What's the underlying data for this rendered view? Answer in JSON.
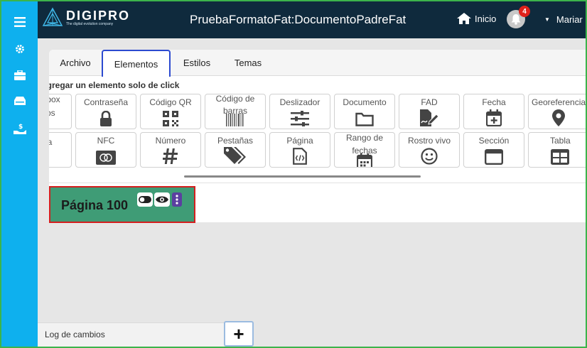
{
  "brand": {
    "name": "DIGIPRO",
    "tagline": "The digital evolution company",
    "accent": "#0eb0ee"
  },
  "header": {
    "title": "PruebaFormatoFat:DocumentoPadreFat",
    "home_label": "Inicio",
    "notifications_count": "4",
    "user_name": "Mariar",
    "user_paren": "("
  },
  "sidebar": {
    "items": [
      "menu-icon",
      "gear-icon",
      "toolbox-icon",
      "drive-icon",
      "money-hand-icon"
    ]
  },
  "tabs": [
    {
      "label": "Archivo"
    },
    {
      "label": "Elementos",
      "active": true
    },
    {
      "label": "Estilos"
    },
    {
      "label": "Temas"
    }
  ],
  "elements": {
    "hint": "Agregar un elemento solo de click",
    "row1": [
      {
        "label": "Checkbox\nGrupos"
      },
      {
        "label": "Contraseña",
        "icon": "lock-icon"
      },
      {
        "label": "Código QR",
        "icon": "qr-icon"
      },
      {
        "label": "Código de\nbarras",
        "icon": "barcode-icon"
      },
      {
        "label": "Deslizador",
        "icon": "sliders-icon"
      },
      {
        "label": "Documento",
        "icon": "folder-icon"
      },
      {
        "label": "FAD",
        "icon": "signature-icon"
      },
      {
        "label": "Fecha",
        "icon": "calendar-plus-icon"
      },
      {
        "label": "Georeferencia",
        "icon": "map-pin-icon"
      }
    ],
    "row2": [
      {
        "label": "Firma"
      },
      {
        "label": "NFC",
        "icon": "nfc-card-icon"
      },
      {
        "label": "Número",
        "icon": "hash-icon"
      },
      {
        "label": "Pestañas",
        "icon": "tags-icon"
      },
      {
        "label": "Página",
        "icon": "code-file-icon"
      },
      {
        "label": "Rango de\nfechas",
        "icon": "calendar-icon"
      },
      {
        "label": "Rostro vivo",
        "icon": "smile-icon"
      },
      {
        "label": "Sección",
        "icon": "window-icon"
      },
      {
        "label": "Tabla",
        "icon": "table-icon"
      }
    ]
  },
  "canvas": {
    "page_label": "Página 100",
    "card_color": "#3f9c76"
  },
  "footer": {
    "log_label": "Log de cambios",
    "add_label": "+"
  }
}
